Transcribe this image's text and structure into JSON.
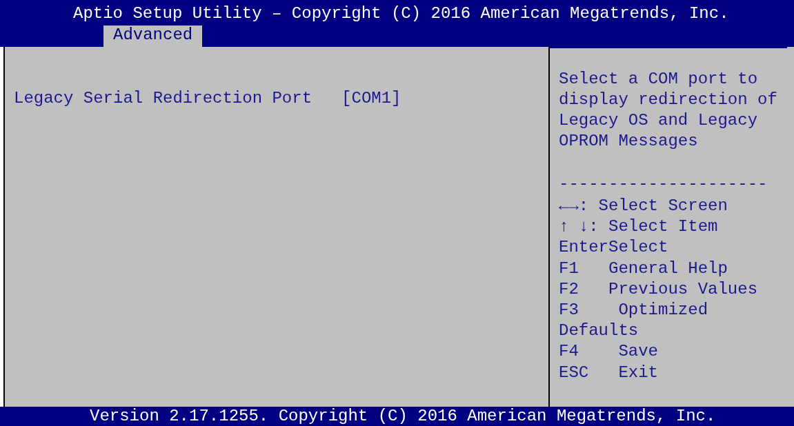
{
  "window": {
    "title": "Aptio Setup Utility – Copyright (C) 2016 American Megatrends, Inc."
  },
  "tabs": [
    {
      "label": "Advanced",
      "selected": true
    }
  ],
  "settings": [
    {
      "label": "Legacy Serial Redirection Port",
      "value": "[COM1]"
    }
  ],
  "help": {
    "description": [
      "Select a COM port to",
      "display redirection of",
      "Legacy OS and Legacy",
      "OPROM Messages"
    ],
    "separator": "---------------------",
    "keys": [
      "←→: Select Screen",
      "↑ ↓: Select Item",
      "EnterSelect",
      "F1   General Help",
      "F2   Previous Values",
      "F3    Optimized",
      "Defaults",
      "F4    Save",
      "ESC   Exit"
    ]
  },
  "status_bar": "Version 2.17.1255. Copyright (C) 2016 American Megatrends, Inc."
}
